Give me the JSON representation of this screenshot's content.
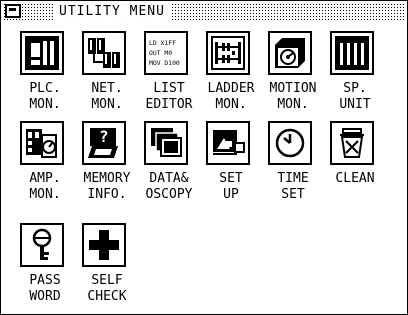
{
  "window": {
    "title": "UTILITY MENU"
  },
  "items": [
    {
      "icon": "plc-monitor-icon",
      "line1": "PLC.",
      "line2": "MON."
    },
    {
      "icon": "network-monitor-icon",
      "line1": "NET.",
      "line2": "MON."
    },
    {
      "icon": "list-editor-icon",
      "line1": "LIST",
      "line2": "EDITOR",
      "icon_text": [
        "LD X1FF",
        "OUT M0",
        "MOV D100"
      ]
    },
    {
      "icon": "ladder-monitor-icon",
      "line1": "LADDER",
      "line2": "MON."
    },
    {
      "icon": "motion-monitor-icon",
      "line1": "MOTION",
      "line2": "MON."
    },
    {
      "icon": "special-unit-icon",
      "line1": "SP.",
      "line2": "UNIT"
    },
    {
      "icon": "amplifier-monitor-icon",
      "line1": "AMP.",
      "line2": "MON."
    },
    {
      "icon": "memory-info-icon",
      "line1": "MEMORY",
      "line2": "INFO."
    },
    {
      "icon": "data-oscilloscope-icon",
      "line1": "DATA&",
      "line2": "OSCOPY"
    },
    {
      "icon": "setup-icon",
      "line1": "SET",
      "line2": "UP"
    },
    {
      "icon": "clock-icon",
      "line1": "TIME",
      "line2": "SET"
    },
    {
      "icon": "clean-icon",
      "line1": "CLEAN",
      "line2": ""
    },
    {
      "icon": "password-key-icon",
      "line1": "PASS",
      "line2": "WORD"
    },
    {
      "icon": "self-check-icon",
      "line1": "SELF",
      "line2": "CHECK"
    }
  ]
}
